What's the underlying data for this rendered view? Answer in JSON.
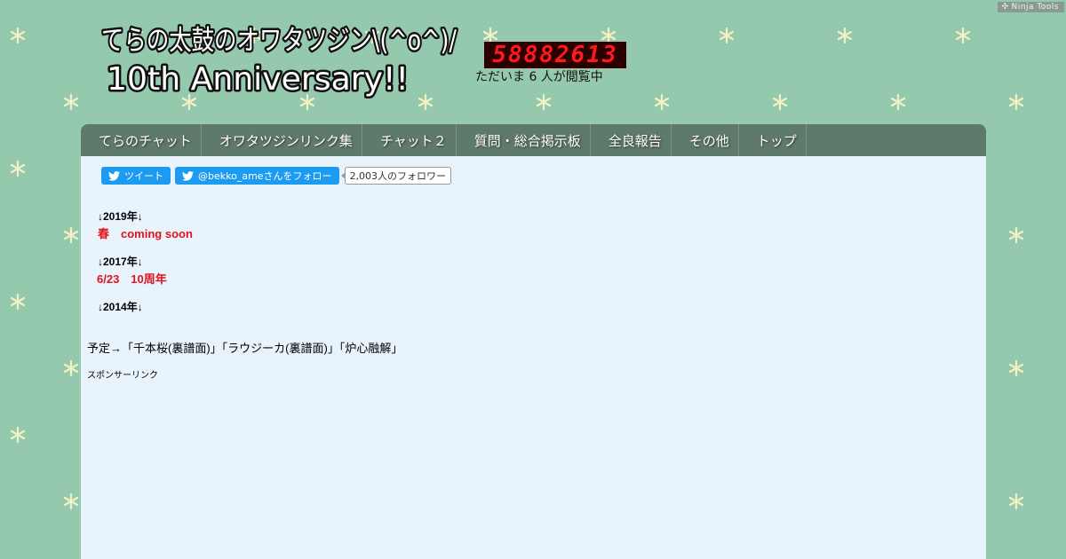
{
  "ninja_tools": {
    "label": "Ninja Tools"
  },
  "header": {
    "logo_line1": "てらの太鼓のオワタツジン\\(^o^)/",
    "logo_line2": "10th Anniversary!!",
    "counter": "58882613",
    "viewers": "ただいま 6 人が閲覧中"
  },
  "nav": {
    "items": [
      {
        "label": "てらのチャット"
      },
      {
        "label": "オワタツジンリンク集"
      },
      {
        "label": "チャット２"
      },
      {
        "label": "質問・総合掲示板"
      },
      {
        "label": "全良報告"
      },
      {
        "label": "その他"
      },
      {
        "label": "トップ"
      }
    ]
  },
  "share": {
    "tweet_label": "ツイート",
    "follow_label": "@bekko_ameさんをフォロー",
    "follower_count": "2,003人のフォロワー"
  },
  "content": {
    "sections": [
      {
        "year": "↓2019年↓",
        "event": "春　coming soon"
      },
      {
        "year": "↓2017年↓",
        "event": "6/23　10周年"
      },
      {
        "year": "↓2014年↓",
        "event": ""
      }
    ],
    "plan": "予定→「千本桜(裏譜面)」「ラウジーカ(裏譜面)」「炉心融解」",
    "sponsor": "スポンサーリンク"
  },
  "colors": {
    "background": "#95c9ad",
    "nav": "#5e7a6a",
    "content": "#e8f3fb",
    "accent_red": "#e0141e",
    "twitter": "#1d9bf0"
  }
}
